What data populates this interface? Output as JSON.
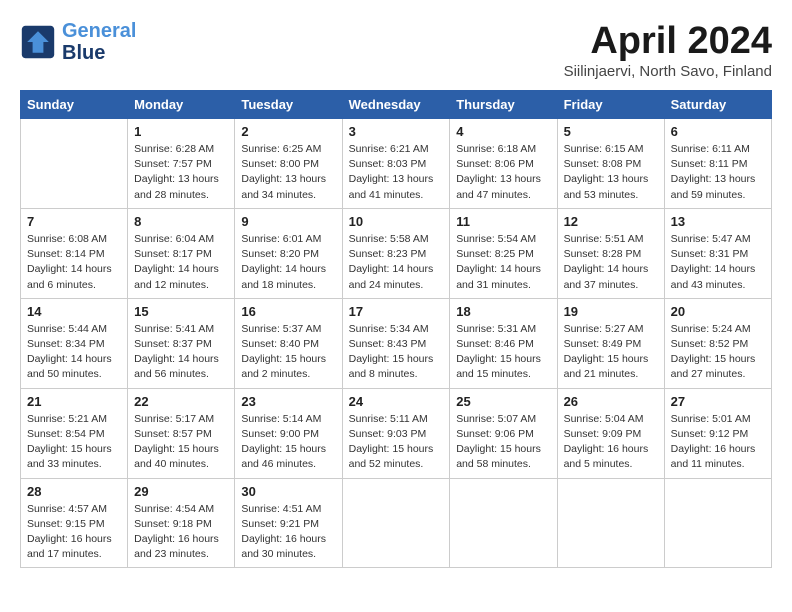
{
  "header": {
    "logo_line1": "General",
    "logo_line2": "Blue",
    "month_title": "April 2024",
    "location": "Siilinjaervi, North Savo, Finland"
  },
  "columns": [
    "Sunday",
    "Monday",
    "Tuesday",
    "Wednesday",
    "Thursday",
    "Friday",
    "Saturday"
  ],
  "weeks": [
    [
      {
        "day": "",
        "info": ""
      },
      {
        "day": "1",
        "info": "Sunrise: 6:28 AM\nSunset: 7:57 PM\nDaylight: 13 hours\nand 28 minutes."
      },
      {
        "day": "2",
        "info": "Sunrise: 6:25 AM\nSunset: 8:00 PM\nDaylight: 13 hours\nand 34 minutes."
      },
      {
        "day": "3",
        "info": "Sunrise: 6:21 AM\nSunset: 8:03 PM\nDaylight: 13 hours\nand 41 minutes."
      },
      {
        "day": "4",
        "info": "Sunrise: 6:18 AM\nSunset: 8:06 PM\nDaylight: 13 hours\nand 47 minutes."
      },
      {
        "day": "5",
        "info": "Sunrise: 6:15 AM\nSunset: 8:08 PM\nDaylight: 13 hours\nand 53 minutes."
      },
      {
        "day": "6",
        "info": "Sunrise: 6:11 AM\nSunset: 8:11 PM\nDaylight: 13 hours\nand 59 minutes."
      }
    ],
    [
      {
        "day": "7",
        "info": "Sunrise: 6:08 AM\nSunset: 8:14 PM\nDaylight: 14 hours\nand 6 minutes."
      },
      {
        "day": "8",
        "info": "Sunrise: 6:04 AM\nSunset: 8:17 PM\nDaylight: 14 hours\nand 12 minutes."
      },
      {
        "day": "9",
        "info": "Sunrise: 6:01 AM\nSunset: 8:20 PM\nDaylight: 14 hours\nand 18 minutes."
      },
      {
        "day": "10",
        "info": "Sunrise: 5:58 AM\nSunset: 8:23 PM\nDaylight: 14 hours\nand 24 minutes."
      },
      {
        "day": "11",
        "info": "Sunrise: 5:54 AM\nSunset: 8:25 PM\nDaylight: 14 hours\nand 31 minutes."
      },
      {
        "day": "12",
        "info": "Sunrise: 5:51 AM\nSunset: 8:28 PM\nDaylight: 14 hours\nand 37 minutes."
      },
      {
        "day": "13",
        "info": "Sunrise: 5:47 AM\nSunset: 8:31 PM\nDaylight: 14 hours\nand 43 minutes."
      }
    ],
    [
      {
        "day": "14",
        "info": "Sunrise: 5:44 AM\nSunset: 8:34 PM\nDaylight: 14 hours\nand 50 minutes."
      },
      {
        "day": "15",
        "info": "Sunrise: 5:41 AM\nSunset: 8:37 PM\nDaylight: 14 hours\nand 56 minutes."
      },
      {
        "day": "16",
        "info": "Sunrise: 5:37 AM\nSunset: 8:40 PM\nDaylight: 15 hours\nand 2 minutes."
      },
      {
        "day": "17",
        "info": "Sunrise: 5:34 AM\nSunset: 8:43 PM\nDaylight: 15 hours\nand 8 minutes."
      },
      {
        "day": "18",
        "info": "Sunrise: 5:31 AM\nSunset: 8:46 PM\nDaylight: 15 hours\nand 15 minutes."
      },
      {
        "day": "19",
        "info": "Sunrise: 5:27 AM\nSunset: 8:49 PM\nDaylight: 15 hours\nand 21 minutes."
      },
      {
        "day": "20",
        "info": "Sunrise: 5:24 AM\nSunset: 8:52 PM\nDaylight: 15 hours\nand 27 minutes."
      }
    ],
    [
      {
        "day": "21",
        "info": "Sunrise: 5:21 AM\nSunset: 8:54 PM\nDaylight: 15 hours\nand 33 minutes."
      },
      {
        "day": "22",
        "info": "Sunrise: 5:17 AM\nSunset: 8:57 PM\nDaylight: 15 hours\nand 40 minutes."
      },
      {
        "day": "23",
        "info": "Sunrise: 5:14 AM\nSunset: 9:00 PM\nDaylight: 15 hours\nand 46 minutes."
      },
      {
        "day": "24",
        "info": "Sunrise: 5:11 AM\nSunset: 9:03 PM\nDaylight: 15 hours\nand 52 minutes."
      },
      {
        "day": "25",
        "info": "Sunrise: 5:07 AM\nSunset: 9:06 PM\nDaylight: 15 hours\nand 58 minutes."
      },
      {
        "day": "26",
        "info": "Sunrise: 5:04 AM\nSunset: 9:09 PM\nDaylight: 16 hours\nand 5 minutes."
      },
      {
        "day": "27",
        "info": "Sunrise: 5:01 AM\nSunset: 9:12 PM\nDaylight: 16 hours\nand 11 minutes."
      }
    ],
    [
      {
        "day": "28",
        "info": "Sunrise: 4:57 AM\nSunset: 9:15 PM\nDaylight: 16 hours\nand 17 minutes."
      },
      {
        "day": "29",
        "info": "Sunrise: 4:54 AM\nSunset: 9:18 PM\nDaylight: 16 hours\nand 23 minutes."
      },
      {
        "day": "30",
        "info": "Sunrise: 4:51 AM\nSunset: 9:21 PM\nDaylight: 16 hours\nand 30 minutes."
      },
      {
        "day": "",
        "info": ""
      },
      {
        "day": "",
        "info": ""
      },
      {
        "day": "",
        "info": ""
      },
      {
        "day": "",
        "info": ""
      }
    ]
  ]
}
